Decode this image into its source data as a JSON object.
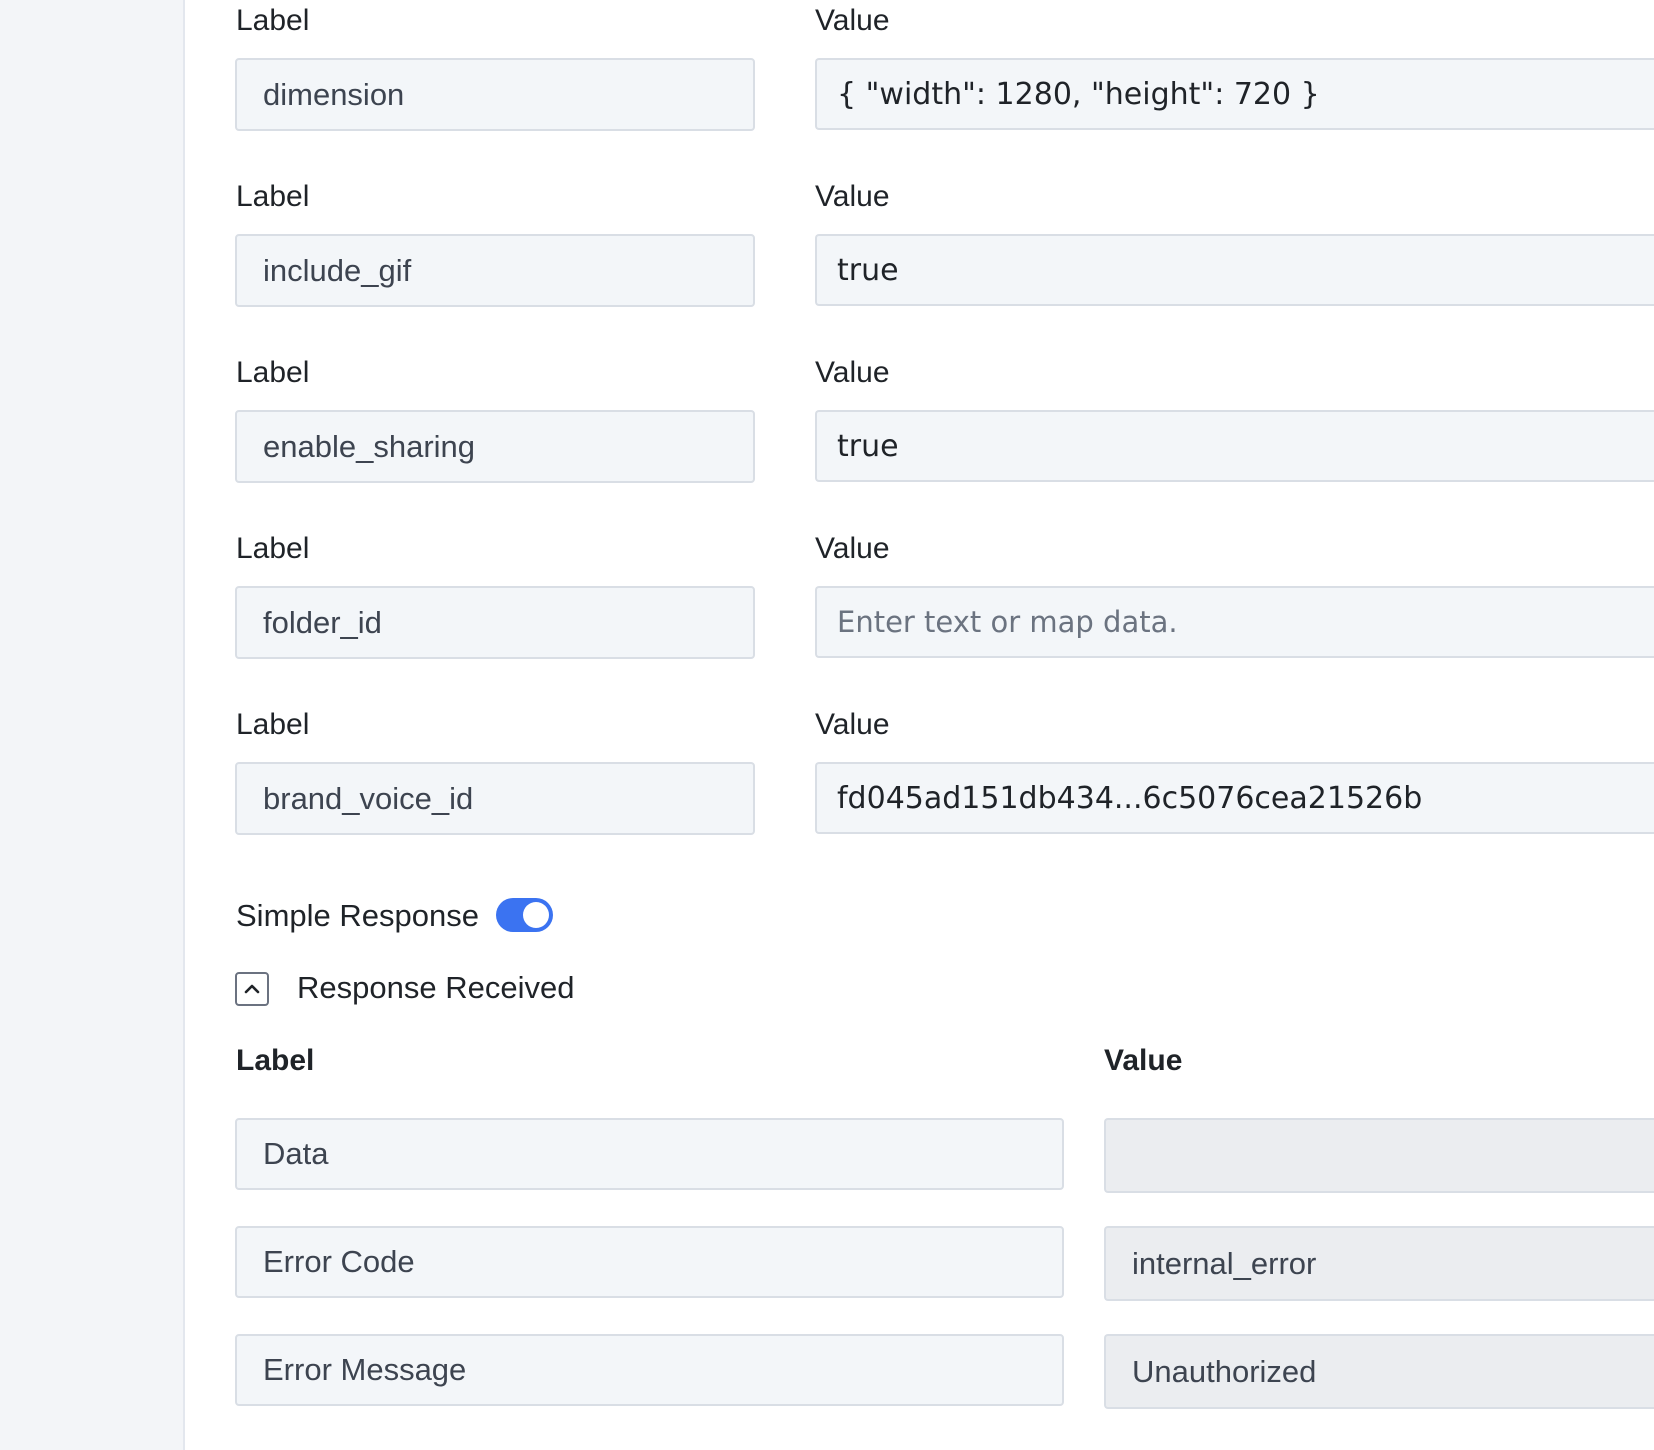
{
  "params": [
    {
      "label_heading": "Label",
      "value_heading": "Value",
      "label": "dimension",
      "value": "{ \"width\": 1280, \"height\": 720 }",
      "placeholder": ""
    },
    {
      "label_heading": "Label",
      "value_heading": "Value",
      "label": "include_gif",
      "value": "true",
      "placeholder": ""
    },
    {
      "label_heading": "Label",
      "value_heading": "Value",
      "label": "enable_sharing",
      "value": "true",
      "placeholder": ""
    },
    {
      "label_heading": "Label",
      "value_heading": "Value",
      "label": "folder_id",
      "value": "",
      "placeholder": "Enter text or map data."
    },
    {
      "label_heading": "Label",
      "value_heading": "Value",
      "label": "brand_voice_id",
      "value": "fd045ad151db434...6c5076cea21526b",
      "placeholder": ""
    }
  ],
  "simple_response": {
    "label": "Simple Response",
    "enabled": true,
    "accent_color": "#3b73f1"
  },
  "response_section": {
    "title": "Response Received",
    "collapse_icon": "chevron-up-icon",
    "label_heading": "Label",
    "value_heading": "Value",
    "rows": [
      {
        "label": "Data",
        "value": ""
      },
      {
        "label": "Error Code",
        "value": "internal_error"
      },
      {
        "label": "Error Message",
        "value": "Unauthorized"
      }
    ]
  }
}
